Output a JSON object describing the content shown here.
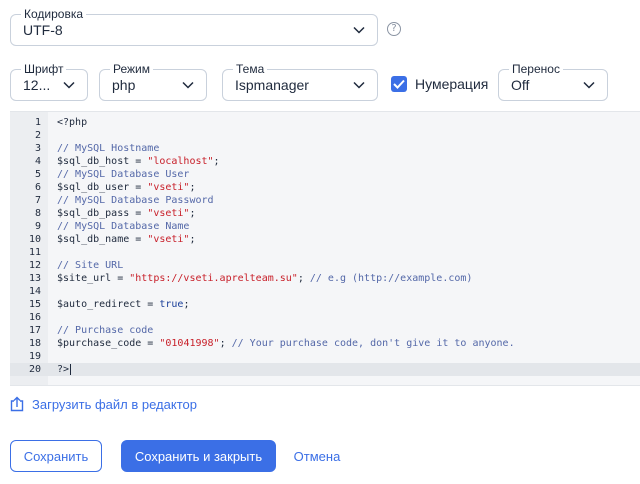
{
  "encoding": {
    "label": "Кодировка",
    "value": "UTF-8",
    "help": "?"
  },
  "font": {
    "label": "Шрифт",
    "value": "12..."
  },
  "mode": {
    "label": "Режим",
    "value": "php"
  },
  "theme": {
    "label": "Тема",
    "value": "Ispmanager"
  },
  "numbering": {
    "label": "Нумерация",
    "checked": true
  },
  "wrap": {
    "label": "Перенос",
    "value": "Off"
  },
  "editor": {
    "active_line": 20,
    "lines": [
      {
        "n": "1",
        "tokens": [
          {
            "t": "<?php",
            "c": "default"
          }
        ]
      },
      {
        "n": "2",
        "tokens": []
      },
      {
        "n": "3",
        "tokens": [
          {
            "t": "// MySQL Hostname",
            "c": "comment"
          }
        ]
      },
      {
        "n": "4",
        "tokens": [
          {
            "t": "$sql_db_host = ",
            "c": "default"
          },
          {
            "t": "\"localhost\"",
            "c": "str"
          },
          {
            "t": ";",
            "c": "default"
          }
        ]
      },
      {
        "n": "5",
        "tokens": [
          {
            "t": "// MySQL Database User",
            "c": "comment"
          }
        ]
      },
      {
        "n": "6",
        "tokens": [
          {
            "t": "$sql_db_user = ",
            "c": "default"
          },
          {
            "t": "\"vseti\"",
            "c": "str"
          },
          {
            "t": ";",
            "c": "default"
          }
        ]
      },
      {
        "n": "7",
        "tokens": [
          {
            "t": "// MySQL Database Password",
            "c": "comment"
          }
        ]
      },
      {
        "n": "8",
        "tokens": [
          {
            "t": "$sql_db_pass = ",
            "c": "default"
          },
          {
            "t": "\"vseti\"",
            "c": "str"
          },
          {
            "t": ";",
            "c": "default"
          }
        ]
      },
      {
        "n": "9",
        "tokens": [
          {
            "t": "// MySQL Database Name",
            "c": "comment"
          }
        ]
      },
      {
        "n": "10",
        "tokens": [
          {
            "t": "$sql_db_name = ",
            "c": "default"
          },
          {
            "t": "\"vseti\"",
            "c": "str"
          },
          {
            "t": ";",
            "c": "default"
          }
        ]
      },
      {
        "n": "11",
        "tokens": []
      },
      {
        "n": "12",
        "tokens": [
          {
            "t": "// Site URL",
            "c": "comment"
          }
        ]
      },
      {
        "n": "13",
        "tokens": [
          {
            "t": "$site_url = ",
            "c": "default"
          },
          {
            "t": "\"https://vseti.aprelteam.su\"",
            "c": "str"
          },
          {
            "t": "; ",
            "c": "default"
          },
          {
            "t": "// e.g (http://example.com)",
            "c": "comment"
          }
        ]
      },
      {
        "n": "14",
        "tokens": []
      },
      {
        "n": "15",
        "tokens": [
          {
            "t": "$auto_redirect = ",
            "c": "default"
          },
          {
            "t": "true",
            "c": "kw"
          },
          {
            "t": ";",
            "c": "default"
          }
        ]
      },
      {
        "n": "16",
        "tokens": []
      },
      {
        "n": "17",
        "tokens": [
          {
            "t": "// Purchase code",
            "c": "comment"
          }
        ]
      },
      {
        "n": "18",
        "tokens": [
          {
            "t": "$purchase_code = ",
            "c": "default"
          },
          {
            "t": "\"01041998\"",
            "c": "str"
          },
          {
            "t": "; ",
            "c": "default"
          },
          {
            "t": "// Your purchase code, don't give it to anyone.",
            "c": "comment"
          }
        ]
      },
      {
        "n": "19",
        "tokens": []
      },
      {
        "n": "20",
        "tokens": [
          {
            "t": "?>",
            "c": "default"
          }
        ]
      }
    ]
  },
  "upload": {
    "label": "Загрузить файл в редактор",
    "icon": "upload-icon"
  },
  "buttons": {
    "save": "Сохранить",
    "save_close": "Сохранить и закрыть",
    "cancel": "Отмена"
  },
  "colors": {
    "accent": "#3b6fe6",
    "string": "#c8202a",
    "comment": "#5468a8"
  }
}
